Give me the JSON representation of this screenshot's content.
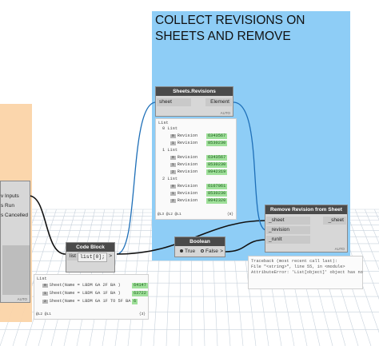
{
  "group": {
    "title_line1": "COLLECT REVISIONS ON",
    "title_line2": "SHEETS AND REMOVE"
  },
  "left_node": {
    "labels": [
      "v Inputs",
      "s Run",
      "s Cancelled"
    ],
    "auto": "AUTO"
  },
  "sheets_revisions": {
    "title": "Sheets.Revisions",
    "in_label": "sheet",
    "out_label": "Element",
    "auto": "AUTO",
    "preview": {
      "root": "List",
      "lists": [
        {
          "header": "0 List",
          "items": [
            {
              "idx": "0",
              "label": "Revision",
              "value": "6343567"
            },
            {
              "idx": "1",
              "label": "Revision",
              "value": "8530230"
            }
          ]
        },
        {
          "header": "1 List",
          "items": [
            {
              "idx": "0",
              "label": "Revision",
              "value": "6343567"
            },
            {
              "idx": "1",
              "label": "Revision",
              "value": "8530230"
            },
            {
              "idx": "2",
              "label": "Revision",
              "value": "9942319"
            }
          ]
        },
        {
          "header": "2 List",
          "items": [
            {
              "idx": "0",
              "label": "Revision",
              "value": "6107061"
            },
            {
              "idx": "1",
              "label": "Revision",
              "value": "8530230"
            },
            {
              "idx": "2",
              "label": "Revision",
              "value": "9942320"
            }
          ]
        }
      ],
      "footer_left": "@L3 @L2 @L1",
      "footer_right": "{8}"
    }
  },
  "code_block": {
    "title": "Code Block",
    "code": "list[0];",
    "out_symbol": ">",
    "in_label": "list",
    "preview": {
      "root": "List",
      "items": [
        {
          "idx": "0",
          "label": "Sheet(Name = LBDM GA 2F BA )",
          "value": "64147"
        },
        {
          "idx": "1",
          "label": "Sheet(Name = LBDM GA 1F BA )",
          "value": "63722"
        },
        {
          "idx": "2",
          "label": "Sheet(Name = LBDM GA 1F TO 5F BA )",
          "value": "6"
        }
      ],
      "footer_left": "@L2 @L1",
      "footer_right": "{3}"
    }
  },
  "boolean_node": {
    "title": "Boolean",
    "true_label": "True",
    "false_label": "False",
    "out_symbol": ">"
  },
  "remove_node": {
    "title": "Remove Revision from Sheet",
    "inputs": [
      "_sheet",
      "_revision",
      "_runIt"
    ],
    "output": "_sheet",
    "auto": "AUTO"
  },
  "error": {
    "lines": [
      "Traceback (most recent call last):",
      "  File \"<string>\", line 55, in <module>",
      "AttributeError: 'List[object]' object has no"
    ]
  }
}
